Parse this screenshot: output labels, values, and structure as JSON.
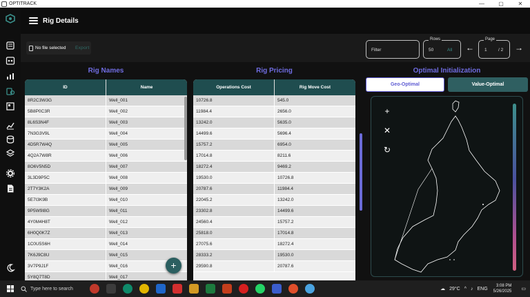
{
  "window": {
    "title": "OPTITRACK",
    "min": "—",
    "max": "▢",
    "close": "✕"
  },
  "header": {
    "title": "Rig Details"
  },
  "toolbar": {
    "file_label": "No file selected",
    "export_label": "Export",
    "filter_placeholder": "Filter",
    "rows_label": "Rows",
    "rows_value": "50",
    "rows_all": "All",
    "page_label": "Page",
    "page_value": "1",
    "page_total": "/ 2",
    "prev": "←",
    "next": "→"
  },
  "sections": {
    "names_title": "Rig Names",
    "pricing_title": "Rig Pricing",
    "optimal_title": "Optimal Initialization"
  },
  "names_table": {
    "headers": [
      "ID",
      "Name"
    ],
    "rows": [
      [
        "8R2C3W3G",
        "Well_001"
      ],
      [
        "5B8P0C3R",
        "Well_002"
      ],
      [
        "8L6S3N4F",
        "Well_003"
      ],
      [
        "7N3G3V9L",
        "Well_004"
      ],
      [
        "4D5R7W4Q",
        "Well_005"
      ],
      [
        "4Q2A7W8R",
        "Well_006"
      ],
      [
        "8O6V5N5D",
        "Well_007"
      ],
      [
        "3L3D9P5C",
        "Well_008"
      ],
      [
        "2T7Y3K2A",
        "Well_009"
      ],
      [
        "5E7I3K9B",
        "Well_010"
      ],
      [
        "9P5W9I8G",
        "Well_011"
      ],
      [
        "4Y0M4H8T",
        "Well_012"
      ],
      [
        "6H0Q0K7Z",
        "Well_013"
      ],
      [
        "1C0U5S6H",
        "Well_014"
      ],
      [
        "7K6J9C8U",
        "Well_015"
      ],
      [
        "3V7P9J1F",
        "Well_016"
      ],
      [
        "5Y8Q7T8D",
        "Well_017"
      ]
    ]
  },
  "pricing_table": {
    "headers": [
      "Operations Cost",
      "Rig Move Cost"
    ],
    "rows": [
      [
        "10726.8",
        "545.0"
      ],
      [
        "11984.4",
        "2656.0"
      ],
      [
        "13242.0",
        "5635.0"
      ],
      [
        "14499.6",
        "5696.4"
      ],
      [
        "15757.2",
        "6954.0"
      ],
      [
        "17014.8",
        "8211.6"
      ],
      [
        "18272.4",
        "9469.2"
      ],
      [
        "19530.0",
        "10726.8"
      ],
      [
        "20787.6",
        "11984.4"
      ],
      [
        "22045.2",
        "13242.0"
      ],
      [
        "23302.8",
        "14499.6"
      ],
      [
        "24560.4",
        "15757.2"
      ],
      [
        "25818.0",
        "17014.8"
      ],
      [
        "27075.6",
        "18272.4"
      ],
      [
        "28333.2",
        "19530.0"
      ],
      [
        "29590.8",
        "20787.6"
      ]
    ]
  },
  "optimal": {
    "tab_geo": "Geo-Optimal",
    "tab_value": "Value-Optimal",
    "zoom_in": "+",
    "close": "✕",
    "refresh": "↻"
  },
  "fab": {
    "label": "+"
  },
  "taskbar": {
    "search_placeholder": "Type here to search",
    "temperature": "29°C",
    "language": "ENG",
    "time": "3:08 PM",
    "date": "5/26/2025"
  },
  "colors": {
    "accent_purple": "#6f6ce0",
    "header_teal": "#1f4d4f",
    "teal_button": "#2f5f61"
  }
}
